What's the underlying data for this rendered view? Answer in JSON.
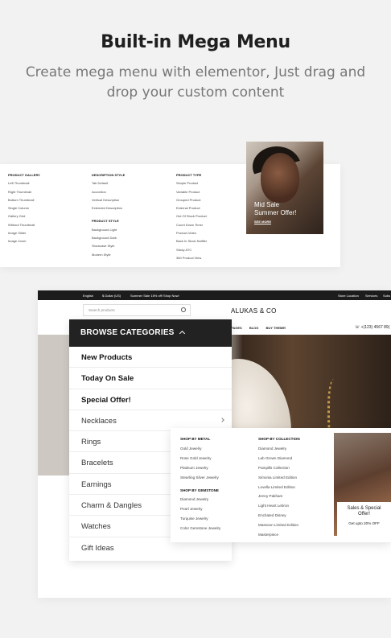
{
  "hero": {
    "title": "Built-in Mega Menu",
    "subtitle": "Create mega menu with elementor, Just drag and drop your custom content"
  },
  "mega_top": {
    "columns": [
      {
        "heading": "Product Gallery",
        "items": [
          "Left Thumbnail",
          "Right Thumbnail",
          "Bottom Thumbnail",
          "Single Column",
          "Gallery Grid",
          "Without Thumbnail",
          "Image Slider",
          "Image Zoom"
        ]
      },
      {
        "heading": "Description Style",
        "items": [
          "Tab Default",
          "Accordion",
          "Vertical Description",
          "Extended Description"
        ],
        "heading2": "Product Style",
        "items2": [
          "Background Light",
          "Background Dark",
          "Showcase Style",
          "Modern Style"
        ]
      },
      {
        "heading": "Product Type",
        "items": [
          "Simple Product",
          "Variable Product",
          "Grouped Product",
          "External Product",
          "Out Of Stock Product",
          "Count Down Timer",
          "Product Video",
          "Back In Stock Notifier",
          "Sticky ATC",
          "360 Product View"
        ]
      }
    ],
    "promo": {
      "line1": "Mid Sale",
      "line2": "Summer Offer!",
      "link": "SEE MORE"
    }
  },
  "store": {
    "topbar": {
      "language": "English",
      "currency": "$ Dollar (US)",
      "promo": "Summer Sale 15% off! Shop Now!",
      "store_location": "Store Location",
      "services": "Services",
      "sub": "Subs"
    },
    "search_placeholder": "Search products",
    "brand": "ALUKAS & CO",
    "nav": [
      "PAGES",
      "BLOG",
      "BUY THEME!"
    ],
    "phone": "+(123) 4567 89(",
    "browse": {
      "title": "BROWSE CATEGORIES",
      "categories": [
        {
          "label": "New Products",
          "bold": true
        },
        {
          "label": "Today On Sale",
          "bold": true
        },
        {
          "label": "Special Offer!",
          "bold": true
        },
        {
          "label": "Necklaces",
          "bold": false
        },
        {
          "label": "Rings",
          "bold": false
        },
        {
          "label": "Bracelets",
          "bold": false
        },
        {
          "label": "Earnings",
          "bold": false
        },
        {
          "label": "Charm & Dangles",
          "bold": false
        },
        {
          "label": "Watches",
          "bold": false
        },
        {
          "label": "Gift Ideas",
          "bold": false
        }
      ]
    },
    "mega": {
      "col1": {
        "heading": "Shop By Metal",
        "items": [
          "Gold Jewelry",
          "Rose Gold Jewelry",
          "Platinum Jewelry",
          "Stearling Silver Jewelry"
        ],
        "heading2": "Shop By Gemstone",
        "items2": [
          "Diamond Jewelry",
          "Pearl Jewelry",
          "Turquise Jewelry",
          "Color Gemstone Jewelry"
        ]
      },
      "col2": {
        "heading": "Shop By Collection",
        "items": [
          "Diamond Jewelry",
          "Lab Grown Diamond",
          "Pampills Collection",
          "Simonia Limited Edition",
          "Lovella Limited Edition",
          "Jenny Pakham",
          "Light Heart Lebron",
          "Enchated Disney",
          "Massoon Limited Edition",
          "Masterpiece"
        ]
      },
      "promo": {
        "line1": "Sales & Special",
        "line2": "Offer!",
        "sub": "Get upto 20% OFF"
      }
    }
  }
}
